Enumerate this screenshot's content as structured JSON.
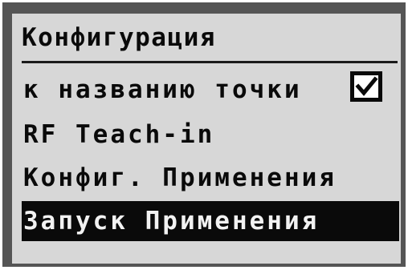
{
  "menu": {
    "title": "Конфигурация",
    "items": [
      {
        "label": "к названию точки",
        "checked": true
      },
      {
        "label": "RF Teach-in"
      },
      {
        "label": "Конфиг. Применения"
      },
      {
        "label": "Запуск Применения",
        "selected": true
      }
    ]
  },
  "icons": {
    "checkbox": "checkmark-icon"
  },
  "colors": {
    "bezel": "#555555",
    "screen": "#d7d7d7",
    "text": "#0a0a0a",
    "highlight_bg": "#0a0a0a",
    "highlight_text": "#f2f2f2"
  }
}
